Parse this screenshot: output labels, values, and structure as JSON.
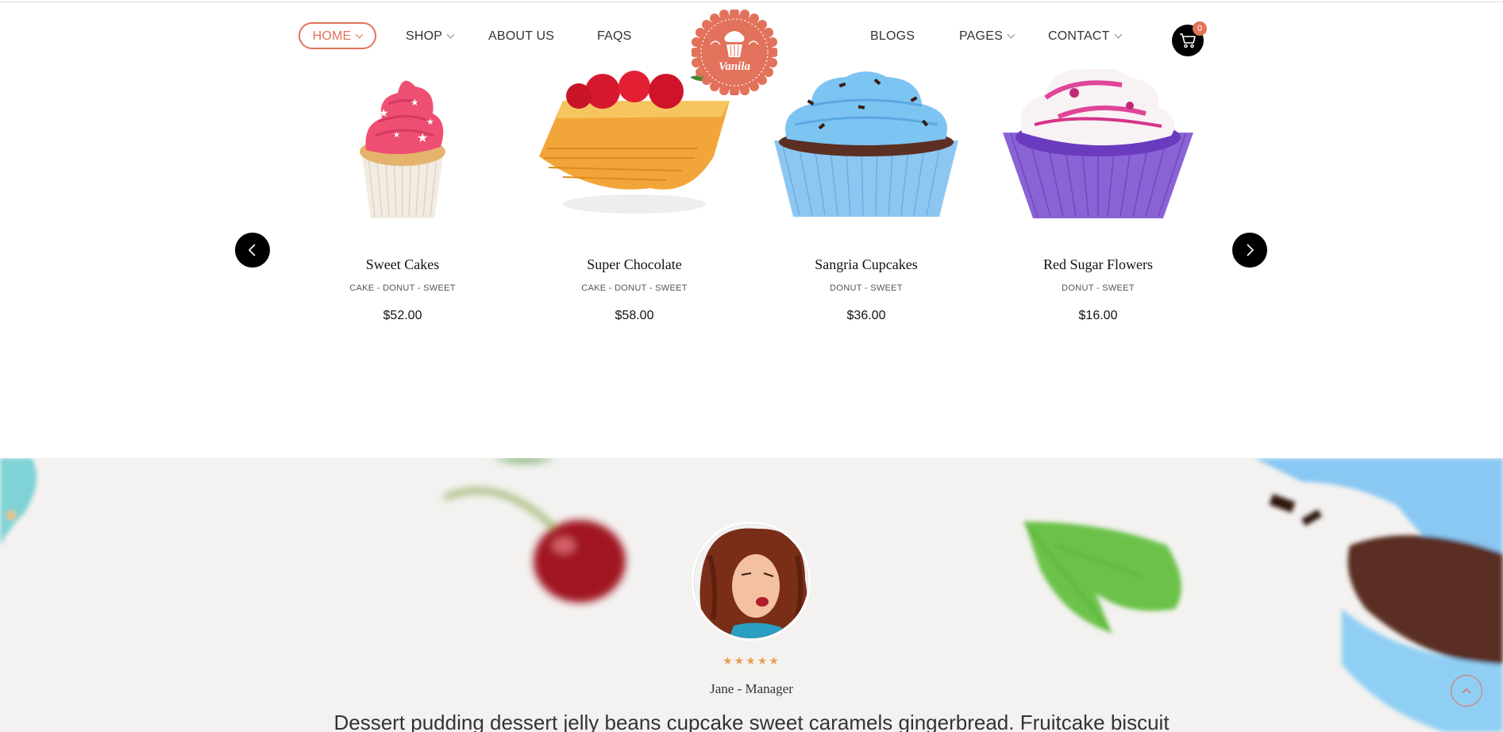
{
  "nav": {
    "items": [
      {
        "label": "HOME",
        "dropdown": true,
        "active": true
      },
      {
        "label": "SHOP",
        "dropdown": true
      },
      {
        "label": "ABOUT US",
        "dropdown": false
      },
      {
        "label": "FAQS",
        "dropdown": false
      },
      {
        "label": "BLOGS",
        "dropdown": false
      },
      {
        "label": "PAGES",
        "dropdown": true
      },
      {
        "label": "CONTACT",
        "dropdown": true
      }
    ],
    "logo_text": "Vanila",
    "cart_count": "0"
  },
  "products": [
    {
      "name": "Sweet Cakes",
      "tags": "CAKE - DONUT - SWEET",
      "price": "$52.00",
      "image": "pink-cupcake"
    },
    {
      "name": "Super Chocolate",
      "tags": "CAKE - DONUT - SWEET",
      "price": "$58.00",
      "image": "strawberry-pastry"
    },
    {
      "name": "Sangria Cupcakes",
      "tags": "DONUT - SWEET",
      "price": "$36.00",
      "image": "blue-cupcake"
    },
    {
      "name": "Red Sugar Flowers",
      "tags": "DONUT - SWEET",
      "price": "$16.00",
      "image": "purple-cupcake"
    }
  ],
  "testimonial": {
    "rating": "★★★★★",
    "author": "Jane - Manager",
    "quote": "Dessert pudding dessert jelly beans cupcake sweet caramels gingerbread. Fruitcake biscuit"
  },
  "colors": {
    "accent": "#e2725b",
    "star": "#e8a04f",
    "testimonial_bg": "#f3f2f0"
  }
}
